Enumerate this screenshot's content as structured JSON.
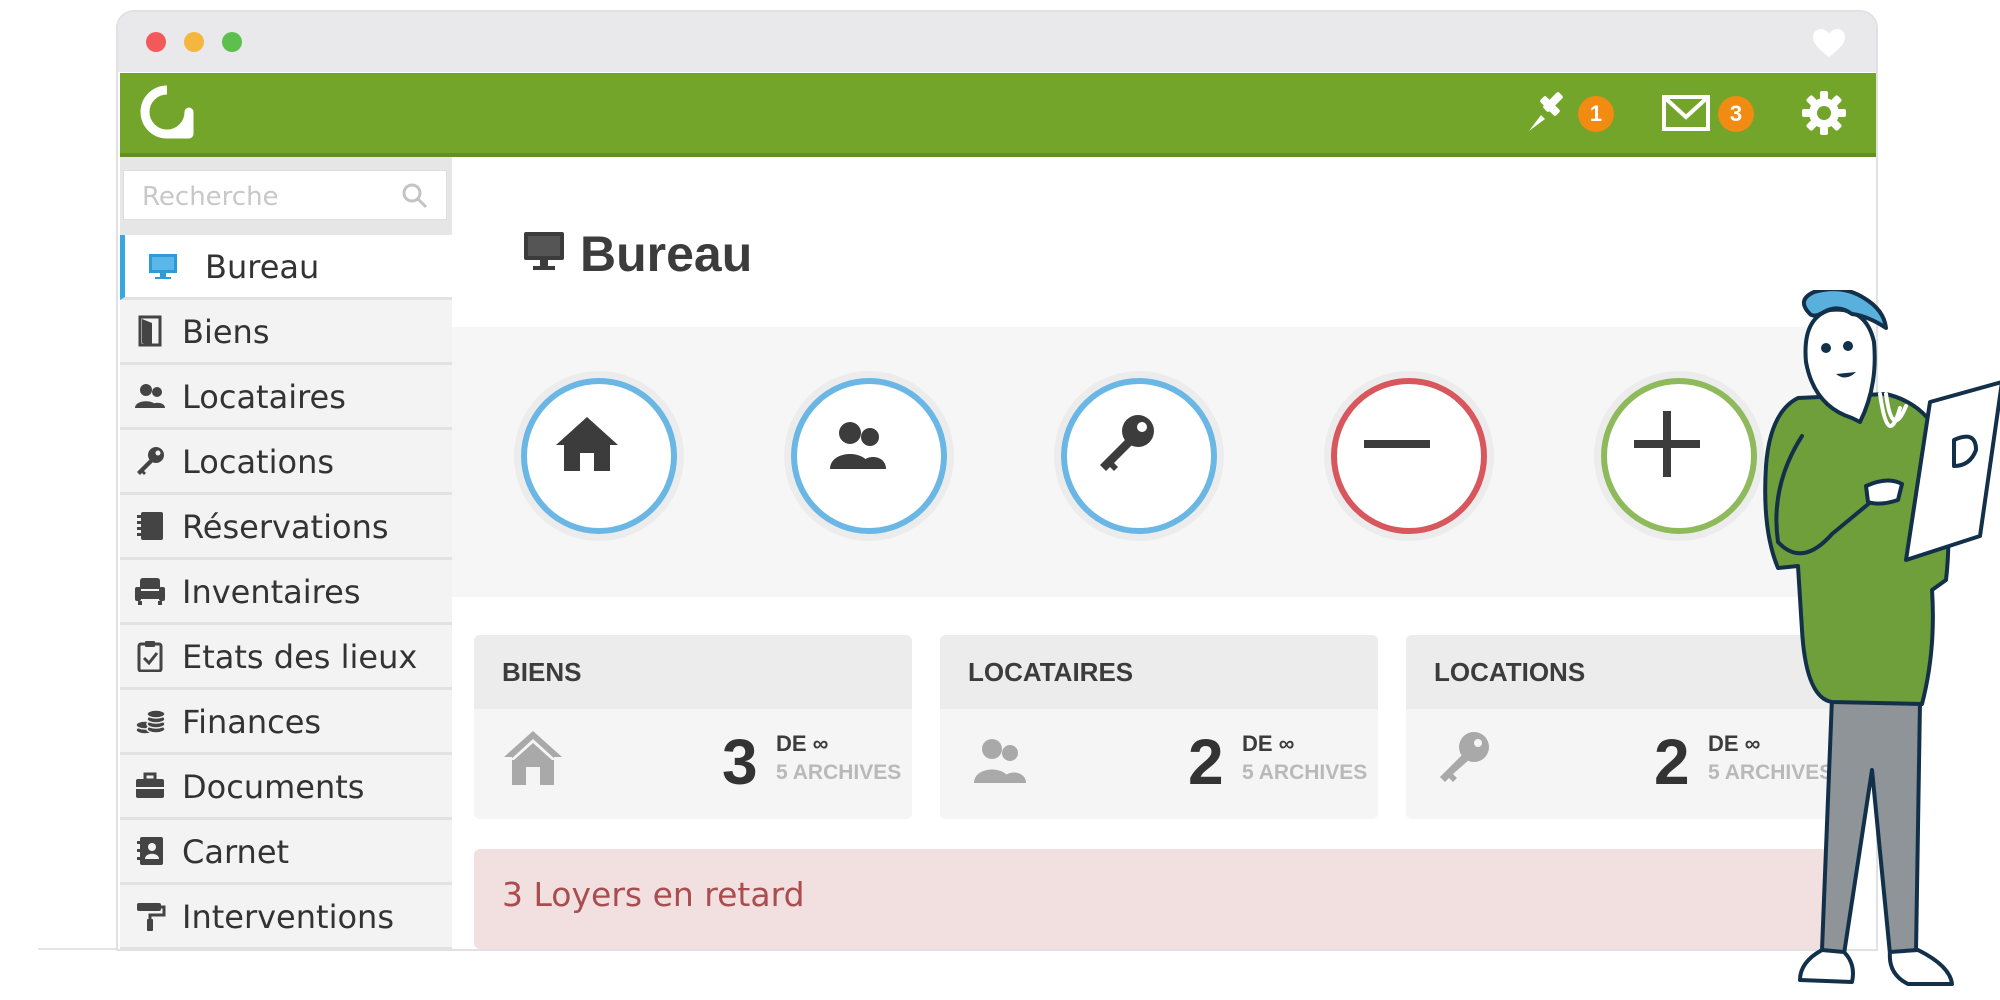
{
  "window": {
    "controls": [
      "close",
      "minimize",
      "maximize"
    ],
    "favorite_icon": "heart-icon"
  },
  "topbar": {
    "logo_icon": "app-logo-icon",
    "pin_icon": "pin-icon",
    "pin_count": "1",
    "mail_icon": "mail-icon",
    "mail_count": "3",
    "settings_icon": "gear-icon"
  },
  "sidebar": {
    "search_placeholder": "Recherche",
    "items": [
      {
        "label": "Bureau",
        "icon": "monitor-icon",
        "active": true
      },
      {
        "label": "Biens",
        "icon": "door-icon"
      },
      {
        "label": "Locataires",
        "icon": "users-icon"
      },
      {
        "label": "Locations",
        "icon": "key-icon"
      },
      {
        "label": "Réservations",
        "icon": "notebook-icon"
      },
      {
        "label": "Inventaires",
        "icon": "armchair-icon"
      },
      {
        "label": "Etats des lieux",
        "icon": "clipboard-check-icon"
      },
      {
        "label": "Finances",
        "icon": "coins-icon"
      },
      {
        "label": "Documents",
        "icon": "briefcase-icon"
      },
      {
        "label": "Carnet",
        "icon": "address-book-icon"
      },
      {
        "label": "Interventions",
        "icon": "paint-roller-icon"
      }
    ]
  },
  "main": {
    "title": "Bureau",
    "title_icon": "monitor-icon",
    "quick_actions": [
      {
        "icon": "home-icon",
        "color": "#6ab7e5"
      },
      {
        "icon": "users-icon",
        "color": "#6ab7e5"
      },
      {
        "icon": "key-icon",
        "color": "#6ab7e5"
      },
      {
        "icon": "minus-icon",
        "color": "#d8575d"
      },
      {
        "icon": "plus-icon",
        "color": "#8fba5c"
      }
    ],
    "stats": [
      {
        "title": "BIENS",
        "icon": "home-icon",
        "count": "3",
        "limit": "DE ∞",
        "archives": "5 ARCHIVES"
      },
      {
        "title": "LOCATAIRES",
        "icon": "users-icon",
        "count": "2",
        "limit": "DE ∞",
        "archives": "5 ARCHIVES"
      },
      {
        "title": "LOCATIONS",
        "icon": "key-icon",
        "count": "2",
        "limit": "DE ∞",
        "archives": "5 ARCHIVES"
      }
    ],
    "alert": "3 Loyers en retard"
  },
  "colors": {
    "topbar": "#73a52b",
    "badge": "#f28b12",
    "active_accent": "#3aa6e0",
    "alert_bg": "#f2dfe0",
    "alert_text": "#a94d4f"
  }
}
